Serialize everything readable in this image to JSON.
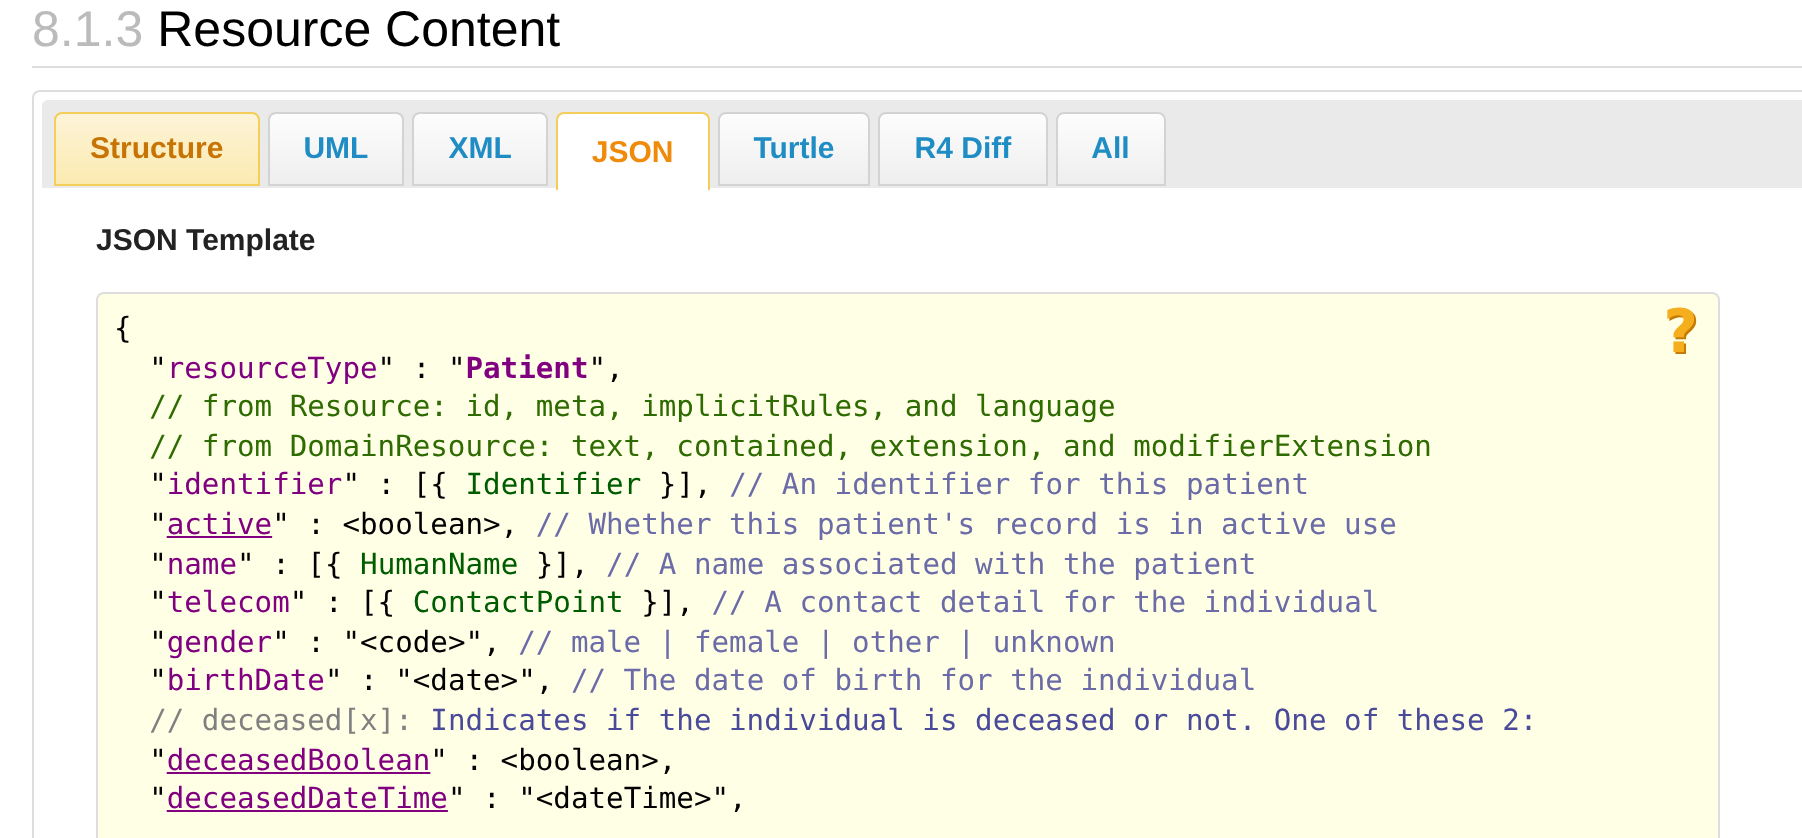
{
  "heading": {
    "number": "8.1.3",
    "title": "Resource Content"
  },
  "tabs": [
    {
      "label": "Structure",
      "selected": false,
      "highlighted": true
    },
    {
      "label": "UML",
      "selected": false,
      "highlighted": false
    },
    {
      "label": "XML",
      "selected": false,
      "highlighted": false
    },
    {
      "label": "JSON",
      "selected": true,
      "highlighted": false
    },
    {
      "label": "Turtle",
      "selected": false,
      "highlighted": false
    },
    {
      "label": "R4 Diff",
      "selected": false,
      "highlighted": false
    },
    {
      "label": "All",
      "selected": false,
      "highlighted": false
    }
  ],
  "section_title": "JSON Template",
  "help_icon": {
    "label": "?"
  },
  "code_lines": [
    [
      {
        "kind": "plain",
        "text": "{"
      }
    ],
    [
      {
        "kind": "plain",
        "text": "  \""
      },
      {
        "kind": "key",
        "text": "resourceType"
      },
      {
        "kind": "plain",
        "text": "\" : \""
      },
      {
        "kind": "value",
        "text": "Patient"
      },
      {
        "kind": "plain",
        "text": "\","
      }
    ],
    [
      {
        "kind": "note",
        "text": "  // from Resource: id, meta, implicitRules, and language"
      }
    ],
    [
      {
        "kind": "note",
        "text": "  // from DomainResource: text, contained, extension, and modifierExtension"
      }
    ],
    [
      {
        "kind": "plain",
        "text": "  \""
      },
      {
        "kind": "key",
        "text": "identifier"
      },
      {
        "kind": "plain",
        "text": "\" : [{ "
      },
      {
        "kind": "type",
        "text": "Identifier"
      },
      {
        "kind": "plain",
        "text": " }], "
      },
      {
        "kind": "comment",
        "text": "// An identifier for this patient"
      }
    ],
    [
      {
        "kind": "plain",
        "text": "  \""
      },
      {
        "kind": "link",
        "text": "active"
      },
      {
        "kind": "plain",
        "text": "\" : <boolean>, "
      },
      {
        "kind": "comment",
        "text": "// Whether this patient's record is in active use"
      }
    ],
    [
      {
        "kind": "plain",
        "text": "  \""
      },
      {
        "kind": "key",
        "text": "name"
      },
      {
        "kind": "plain",
        "text": "\" : [{ "
      },
      {
        "kind": "type",
        "text": "HumanName"
      },
      {
        "kind": "plain",
        "text": " }], "
      },
      {
        "kind": "comment",
        "text": "// A name associated with the patient"
      }
    ],
    [
      {
        "kind": "plain",
        "text": "  \""
      },
      {
        "kind": "key",
        "text": "telecom"
      },
      {
        "kind": "plain",
        "text": "\" : [{ "
      },
      {
        "kind": "type",
        "text": "ContactPoint"
      },
      {
        "kind": "plain",
        "text": " }], "
      },
      {
        "kind": "comment",
        "text": "// A contact detail for the individual"
      }
    ],
    [
      {
        "kind": "plain",
        "text": "  \""
      },
      {
        "kind": "key",
        "text": "gender"
      },
      {
        "kind": "plain",
        "text": "\" : \"<code>\", "
      },
      {
        "kind": "comment",
        "text": "// male | female | other | unknown"
      }
    ],
    [
      {
        "kind": "plain",
        "text": "  \""
      },
      {
        "kind": "key",
        "text": "birthDate"
      },
      {
        "kind": "plain",
        "text": "\" : \"<date>\", "
      },
      {
        "kind": "comment",
        "text": "// The date of birth for the individual"
      }
    ],
    [
      {
        "kind": "choice",
        "text": "  // deceased[x]: "
      },
      {
        "kind": "explain",
        "text": "Indicates if the individual is deceased or not. One of these 2:"
      }
    ],
    [
      {
        "kind": "plain",
        "text": "  \""
      },
      {
        "kind": "link",
        "text": "deceasedBoolean"
      },
      {
        "kind": "plain",
        "text": "\" : <boolean>,"
      }
    ],
    [
      {
        "kind": "plain",
        "text": "  \""
      },
      {
        "kind": "link",
        "text": "deceasedDateTime"
      },
      {
        "kind": "plain",
        "text": "\" : \"<dateTime>\","
      }
    ]
  ]
}
